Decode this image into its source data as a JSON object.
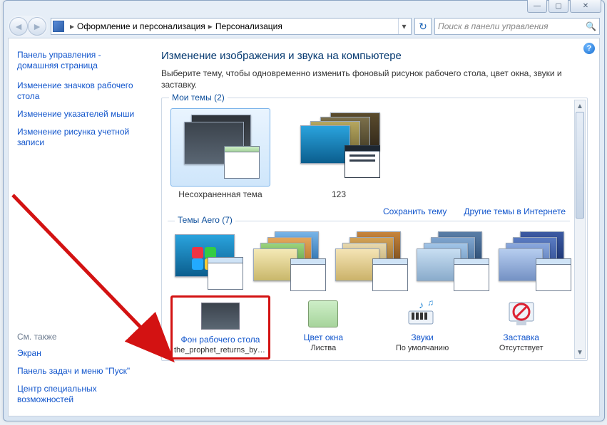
{
  "window_controls": {
    "min": "—",
    "max": "▢",
    "close": "✕"
  },
  "breadcrumb": {
    "part1": "Оформление и персонализация",
    "part2": "Персонализация"
  },
  "search": {
    "placeholder": "Поиск в панели управления"
  },
  "sidebar": {
    "home": "Панель управления - домашняя страница",
    "links": [
      "Изменение значков рабочего стола",
      "Изменение указателей мыши",
      "Изменение рисунка учетной записи"
    ],
    "see_also_head": "См. также",
    "see_also": [
      "Экран",
      "Панель задач и меню \"Пуск\"",
      "Центр специальных возможностей"
    ]
  },
  "content": {
    "title": "Изменение изображения и звука на компьютере",
    "subtitle": "Выберите тему, чтобы одновременно изменить фоновый рисунок рабочего стола, цвет окна, звуки и заставку.",
    "group_my": "Мои темы (2)",
    "my_themes": [
      {
        "label": "Несохраненная тема"
      },
      {
        "label": "123"
      }
    ],
    "save_theme": "Сохранить тему",
    "more_themes": "Другие темы в Интернете",
    "group_aero": "Темы Aero (7)",
    "bottom": [
      {
        "label": "Фон рабочего стола",
        "value": "the_prophet_returns_by_m..."
      },
      {
        "label": "Цвет окна",
        "value": "Листва"
      },
      {
        "label": "Звуки",
        "value": "По умолчанию"
      },
      {
        "label": "Заставка",
        "value": "Отсутствует"
      }
    ]
  }
}
